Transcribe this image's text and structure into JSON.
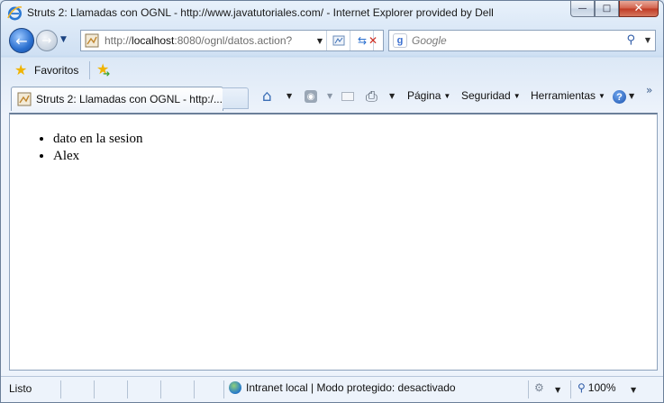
{
  "window": {
    "title": "Struts 2: Llamadas con OGNL - http://www.javatutoriales.com/ - Internet Explorer provided by Dell",
    "minimize_glyph": "—",
    "maximize_glyph": "□",
    "close_glyph": "✕"
  },
  "nav": {
    "back_glyph": "←",
    "forward_glyph": "→",
    "address_prefix": "http://",
    "address_host": "localhost",
    "address_rest": ":8080/ognl/datos.action?",
    "search_engine_glyph": "g",
    "search_placeholder": "Google"
  },
  "favorites": {
    "label": "Favoritos"
  },
  "tab": {
    "title": "Struts 2: Llamadas con OGNL - http:/..."
  },
  "commandbar": {
    "page_label": "Página",
    "safety_label": "Seguridad",
    "tools_label": "Herramientas",
    "help_glyph": "?",
    "chevron": "»"
  },
  "content": {
    "items": [
      "dato en la sesion",
      "Alex"
    ]
  },
  "status": {
    "text": "Listo",
    "zone": "Intranet local | Modo protegido: desactivado",
    "zoom": "100%"
  },
  "icons": {
    "app": "ie-logo-icon",
    "page": "page-icon",
    "home": "home-icon",
    "rss": "rss-feed-icon",
    "mail": "read-mail-icon",
    "print": "print-icon",
    "help": "help-icon"
  }
}
